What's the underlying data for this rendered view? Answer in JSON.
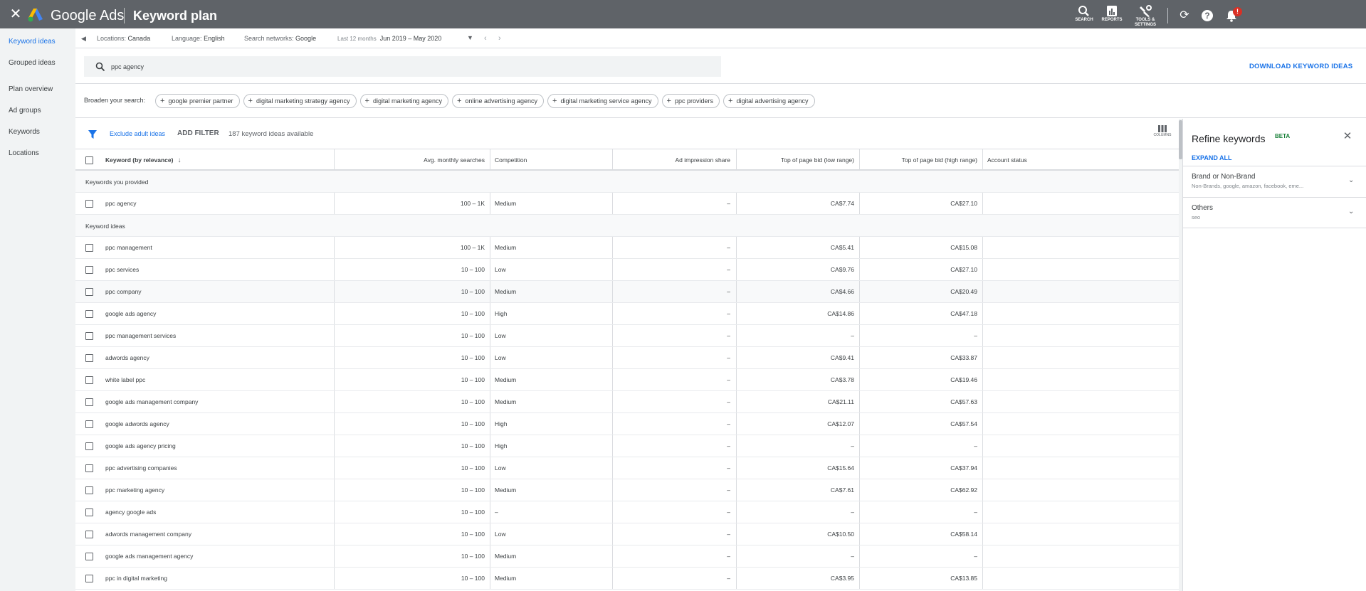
{
  "topbar": {
    "close_glyph": "✕",
    "brand": "Google Ads",
    "page_title": "Keyword plan",
    "tools": [
      {
        "label": "SEARCH",
        "icon": "search-icon"
      },
      {
        "label": "REPORTS",
        "icon": "reports-icon"
      },
      {
        "label": "TOOLS & SETTINGS",
        "icon": "wrench-icon"
      }
    ],
    "refresh_glyph": "⟳",
    "help_glyph": "?",
    "notification_badge": "!"
  },
  "sidebar": {
    "items": [
      {
        "label": "Keyword ideas",
        "active": true
      },
      {
        "label": "Grouped ideas",
        "active": false
      },
      {
        "label": "Plan overview",
        "active": false
      },
      {
        "label": "Ad groups",
        "active": false
      },
      {
        "label": "Keywords",
        "active": false
      },
      {
        "label": "Locations",
        "active": false
      }
    ]
  },
  "toolbar": {
    "locations_label": "Locations:",
    "locations_value": "Canada",
    "language_label": "Language:",
    "language_value": "English",
    "networks_label": "Search networks:",
    "networks_value": "Google",
    "period_label": "Last 12 months",
    "period_value": "Jun 2019 – May 2020"
  },
  "search": {
    "value": "ppc agency",
    "placeholder": "",
    "download_label": "DOWNLOAD KEYWORD IDEAS"
  },
  "broaden": {
    "label": "Broaden your search:",
    "chips": [
      "google premier partner",
      "digital marketing strategy agency",
      "digital marketing agency",
      "online advertising agency",
      "digital marketing service agency",
      "ppc providers",
      "digital advertising agency"
    ]
  },
  "filters": {
    "exclude_label": "Exclude adult ideas",
    "add_filter_label": "ADD FILTER",
    "count_text": "187 keyword ideas available",
    "columns_label": "COLUMNS"
  },
  "table": {
    "headers": {
      "keyword": "Keyword (by relevance)",
      "avg": "Avg. monthly searches",
      "competition": "Competition",
      "share": "Ad impression share",
      "low": "Top of page bid (low range)",
      "high": "Top of page bid (high range)",
      "status": "Account status"
    },
    "provided_section": "Keywords you provided",
    "provided": [
      {
        "keyword": "ppc agency",
        "avg": "100 – 1K",
        "competition": "Medium",
        "share": "–",
        "low": "CA$7.74",
        "high": "CA$27.10",
        "status": ""
      }
    ],
    "ideas_section": "Keyword ideas",
    "ideas": [
      {
        "keyword": "ppc management",
        "avg": "100 – 1K",
        "competition": "Medium",
        "share": "–",
        "low": "CA$5.41",
        "high": "CA$15.08",
        "status": ""
      },
      {
        "keyword": "ppc services",
        "avg": "10 – 100",
        "competition": "Low",
        "share": "–",
        "low": "CA$9.76",
        "high": "CA$27.10",
        "status": ""
      },
      {
        "keyword": "ppc company",
        "avg": "10 – 100",
        "competition": "Medium",
        "share": "–",
        "low": "CA$4.66",
        "high": "CA$20.49",
        "status": ""
      },
      {
        "keyword": "google ads agency",
        "avg": "10 – 100",
        "competition": "High",
        "share": "–",
        "low": "CA$14.86",
        "high": "CA$47.18",
        "status": ""
      },
      {
        "keyword": "ppc management services",
        "avg": "10 – 100",
        "competition": "Low",
        "share": "–",
        "low": "–",
        "high": "–",
        "status": ""
      },
      {
        "keyword": "adwords agency",
        "avg": "10 – 100",
        "competition": "Low",
        "share": "–",
        "low": "CA$9.41",
        "high": "CA$33.87",
        "status": ""
      },
      {
        "keyword": "white label ppc",
        "avg": "10 – 100",
        "competition": "Medium",
        "share": "–",
        "low": "CA$3.78",
        "high": "CA$19.46",
        "status": ""
      },
      {
        "keyword": "google ads management company",
        "avg": "10 – 100",
        "competition": "Medium",
        "share": "–",
        "low": "CA$21.11",
        "high": "CA$57.63",
        "status": ""
      },
      {
        "keyword": "google adwords agency",
        "avg": "10 – 100",
        "competition": "High",
        "share": "–",
        "low": "CA$12.07",
        "high": "CA$57.54",
        "status": ""
      },
      {
        "keyword": "google ads agency pricing",
        "avg": "10 – 100",
        "competition": "High",
        "share": "–",
        "low": "–",
        "high": "–",
        "status": ""
      },
      {
        "keyword": "ppc advertising companies",
        "avg": "10 – 100",
        "competition": "Low",
        "share": "–",
        "low": "CA$15.64",
        "high": "CA$37.94",
        "status": ""
      },
      {
        "keyword": "ppc marketing agency",
        "avg": "10 – 100",
        "competition": "Medium",
        "share": "–",
        "low": "CA$7.61",
        "high": "CA$62.92",
        "status": ""
      },
      {
        "keyword": "agency google ads",
        "avg": "10 – 100",
        "competition": "–",
        "share": "–",
        "low": "–",
        "high": "–",
        "status": ""
      },
      {
        "keyword": "adwords management company",
        "avg": "10 – 100",
        "competition": "Low",
        "share": "–",
        "low": "CA$10.50",
        "high": "CA$58.14",
        "status": ""
      },
      {
        "keyword": "google ads management agency",
        "avg": "10 – 100",
        "competition": "Medium",
        "share": "–",
        "low": "–",
        "high": "–",
        "status": ""
      },
      {
        "keyword": "ppc in digital marketing",
        "avg": "10 – 100",
        "competition": "Medium",
        "share": "–",
        "low": "CA$3.95",
        "high": "CA$13.85",
        "status": ""
      }
    ]
  },
  "refine": {
    "title": "Refine keywords",
    "badge": "BETA",
    "close_glyph": "✕",
    "expand_all": "EXPAND ALL",
    "groups": [
      {
        "title": "Brand or Non-Brand",
        "subtitle": "Non-Brands, google, amazon, facebook, eme..."
      },
      {
        "title": "Others",
        "subtitle": "seo"
      }
    ]
  },
  "colors": {
    "topbar": "#5f6368",
    "accent": "#1a73e8",
    "beta": "#188038",
    "notification": "#d93025"
  }
}
